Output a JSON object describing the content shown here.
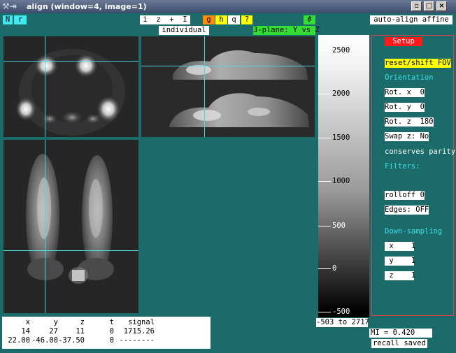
{
  "window": {
    "title": "align (window=4, image=1)",
    "buttons": [
      "▫",
      "□",
      "×"
    ]
  },
  "toolbar": {
    "N": "N",
    "r": "r",
    "izI": "i  z  +  I",
    "g": "g",
    "h": "h",
    "q": "q",
    "help": "?",
    "hash": "#",
    "auto_align": "auto-align affine",
    "individual": "individual",
    "plane_mode": "3-plane: Y vs Z"
  },
  "colorbar": {
    "ticks": [
      "2500",
      "2000",
      "1500",
      "1000",
      "500",
      "0",
      "-500"
    ],
    "range_label": "-503 to 2717"
  },
  "setup": {
    "tab": "Setup",
    "reset": "reset/shift FOV",
    "orientation": "Orientation",
    "rot_x": "Rot. x  0",
    "rot_y": "Rot. y  0",
    "rot_z": "Rot. z  180",
    "swap_z": "Swap z: No",
    "conserves": "conserves parity",
    "filters": "Filters:",
    "rolloff": "rolloff 0",
    "edges": "Edges: OFF",
    "downsampling": "Down-sampling",
    "ds_x": " x    1",
    "ds_y": " y    1",
    "ds_z": " z    1"
  },
  "info": {
    "headers": [
      "x",
      "y",
      "z",
      "t",
      "signal"
    ],
    "row_vox": [
      "14",
      "27",
      "11",
      "0",
      "1715.26"
    ],
    "row_mm": [
      "22.00",
      "-46.00",
      "-37.50",
      "0",
      "--------"
    ]
  },
  "mi_label": "MI = 0.420",
  "recall_label": "recall saved",
  "colors": {
    "background": "#1b6b6b",
    "crosshair": "#4ed8e0",
    "setup_border": "#e84040",
    "setup_tab": "#ff1a1a",
    "orange": "#ff8c00",
    "yellow": "#ffff00",
    "green": "#33dd33"
  }
}
